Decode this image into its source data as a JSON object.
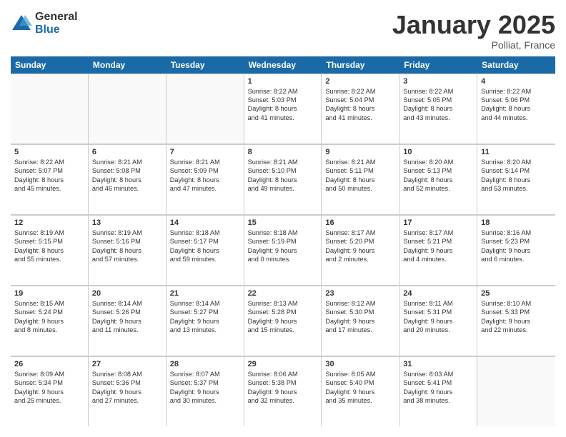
{
  "logo": {
    "general": "General",
    "blue": "Blue"
  },
  "title": "January 2025",
  "location": "Polliat, France",
  "days": [
    "Sunday",
    "Monday",
    "Tuesday",
    "Wednesday",
    "Thursday",
    "Friday",
    "Saturday"
  ],
  "weeks": [
    [
      {
        "day": "",
        "content": ""
      },
      {
        "day": "",
        "content": ""
      },
      {
        "day": "",
        "content": ""
      },
      {
        "day": "1",
        "content": "Sunrise: 8:22 AM\nSunset: 5:03 PM\nDaylight: 8 hours\nand 41 minutes."
      },
      {
        "day": "2",
        "content": "Sunrise: 8:22 AM\nSunset: 5:04 PM\nDaylight: 8 hours\nand 41 minutes."
      },
      {
        "day": "3",
        "content": "Sunrise: 8:22 AM\nSunset: 5:05 PM\nDaylight: 8 hours\nand 43 minutes."
      },
      {
        "day": "4",
        "content": "Sunrise: 8:22 AM\nSunset: 5:06 PM\nDaylight: 8 hours\nand 44 minutes."
      }
    ],
    [
      {
        "day": "5",
        "content": "Sunrise: 8:22 AM\nSunset: 5:07 PM\nDaylight: 8 hours\nand 45 minutes."
      },
      {
        "day": "6",
        "content": "Sunrise: 8:21 AM\nSunset: 5:08 PM\nDaylight: 8 hours\nand 46 minutes."
      },
      {
        "day": "7",
        "content": "Sunrise: 8:21 AM\nSunset: 5:09 PM\nDaylight: 8 hours\nand 47 minutes."
      },
      {
        "day": "8",
        "content": "Sunrise: 8:21 AM\nSunset: 5:10 PM\nDaylight: 8 hours\nand 49 minutes."
      },
      {
        "day": "9",
        "content": "Sunrise: 8:21 AM\nSunset: 5:11 PM\nDaylight: 8 hours\nand 50 minutes."
      },
      {
        "day": "10",
        "content": "Sunrise: 8:20 AM\nSunset: 5:13 PM\nDaylight: 8 hours\nand 52 minutes."
      },
      {
        "day": "11",
        "content": "Sunrise: 8:20 AM\nSunset: 5:14 PM\nDaylight: 8 hours\nand 53 minutes."
      }
    ],
    [
      {
        "day": "12",
        "content": "Sunrise: 8:19 AM\nSunset: 5:15 PM\nDaylight: 8 hours\nand 55 minutes."
      },
      {
        "day": "13",
        "content": "Sunrise: 8:19 AM\nSunset: 5:16 PM\nDaylight: 8 hours\nand 57 minutes."
      },
      {
        "day": "14",
        "content": "Sunrise: 8:18 AM\nSunset: 5:17 PM\nDaylight: 8 hours\nand 59 minutes."
      },
      {
        "day": "15",
        "content": "Sunrise: 8:18 AM\nSunset: 5:19 PM\nDaylight: 9 hours\nand 0 minutes."
      },
      {
        "day": "16",
        "content": "Sunrise: 8:17 AM\nSunset: 5:20 PM\nDaylight: 9 hours\nand 2 minutes."
      },
      {
        "day": "17",
        "content": "Sunrise: 8:17 AM\nSunset: 5:21 PM\nDaylight: 9 hours\nand 4 minutes."
      },
      {
        "day": "18",
        "content": "Sunrise: 8:16 AM\nSunset: 5:23 PM\nDaylight: 9 hours\nand 6 minutes."
      }
    ],
    [
      {
        "day": "19",
        "content": "Sunrise: 8:15 AM\nSunset: 5:24 PM\nDaylight: 9 hours\nand 8 minutes."
      },
      {
        "day": "20",
        "content": "Sunrise: 8:14 AM\nSunset: 5:26 PM\nDaylight: 9 hours\nand 11 minutes."
      },
      {
        "day": "21",
        "content": "Sunrise: 8:14 AM\nSunset: 5:27 PM\nDaylight: 9 hours\nand 13 minutes."
      },
      {
        "day": "22",
        "content": "Sunrise: 8:13 AM\nSunset: 5:28 PM\nDaylight: 9 hours\nand 15 minutes."
      },
      {
        "day": "23",
        "content": "Sunrise: 8:12 AM\nSunset: 5:30 PM\nDaylight: 9 hours\nand 17 minutes."
      },
      {
        "day": "24",
        "content": "Sunrise: 8:11 AM\nSunset: 5:31 PM\nDaylight: 9 hours\nand 20 minutes."
      },
      {
        "day": "25",
        "content": "Sunrise: 8:10 AM\nSunset: 5:33 PM\nDaylight: 9 hours\nand 22 minutes."
      }
    ],
    [
      {
        "day": "26",
        "content": "Sunrise: 8:09 AM\nSunset: 5:34 PM\nDaylight: 9 hours\nand 25 minutes."
      },
      {
        "day": "27",
        "content": "Sunrise: 8:08 AM\nSunset: 5:36 PM\nDaylight: 9 hours\nand 27 minutes."
      },
      {
        "day": "28",
        "content": "Sunrise: 8:07 AM\nSunset: 5:37 PM\nDaylight: 9 hours\nand 30 minutes."
      },
      {
        "day": "29",
        "content": "Sunrise: 8:06 AM\nSunset: 5:38 PM\nDaylight: 9 hours\nand 32 minutes."
      },
      {
        "day": "30",
        "content": "Sunrise: 8:05 AM\nSunset: 5:40 PM\nDaylight: 9 hours\nand 35 minutes."
      },
      {
        "day": "31",
        "content": "Sunrise: 8:03 AM\nSunset: 5:41 PM\nDaylight: 9 hours\nand 38 minutes."
      },
      {
        "day": "",
        "content": ""
      }
    ]
  ]
}
